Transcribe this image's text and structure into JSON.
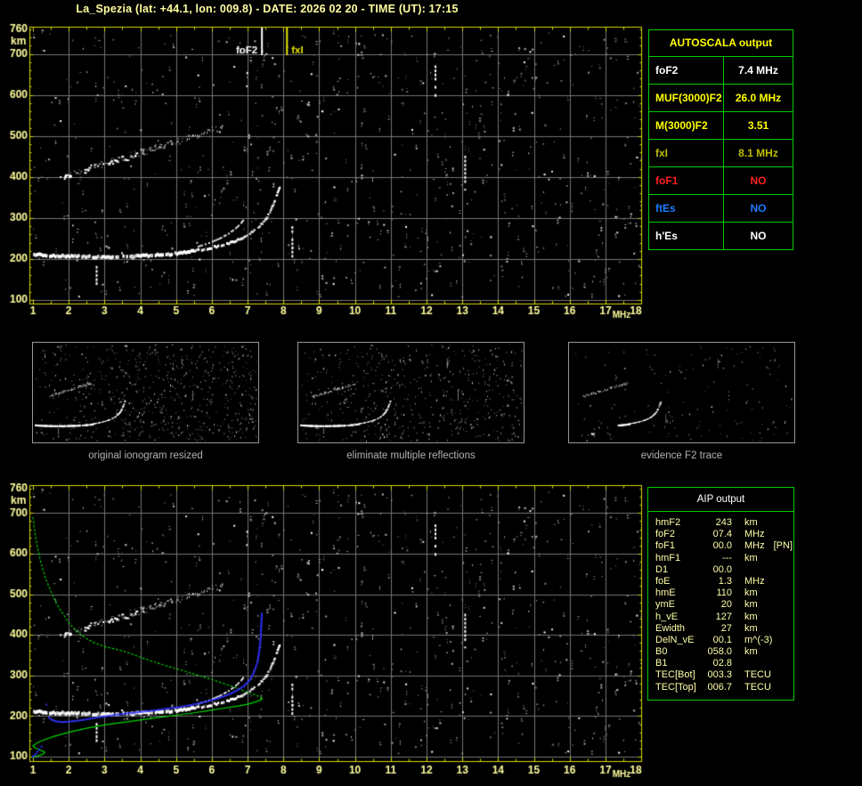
{
  "title": "La_Spezia (lat: +44.1, lon: 009.8) - DATE: 2026 02 20 - TIME (UT): 17:15",
  "autoscala": {
    "header": "AUTOSCALA output",
    "rows": [
      {
        "label": "foF2",
        "value": "7.4 MHz",
        "color": "#ffffff"
      },
      {
        "label": "MUF(3000)F2",
        "value": "26.0 MHz",
        "color": "#ffff00"
      },
      {
        "label": "M(3000)F2",
        "value": "3.51",
        "color": "#ffff00"
      },
      {
        "label": "fxI",
        "value": "8.1 MHz",
        "color": "#bcbc00"
      },
      {
        "label": "foF1",
        "value": "NO",
        "color": "#ff2020"
      },
      {
        "label": "ftEs",
        "value": "NO",
        "color": "#2079ff"
      },
      {
        "label": "h'Es",
        "value": "NO",
        "color": "#ffffff"
      }
    ]
  },
  "aip": {
    "header": "AIP output",
    "rows": [
      {
        "name": "hmF2",
        "value": "243",
        "unit": "km",
        "extra": ""
      },
      {
        "name": "foF2",
        "value": "07.4",
        "unit": "MHz",
        "extra": ""
      },
      {
        "name": "foF1",
        "value": "00.0",
        "unit": "MHz",
        "extra": "[PN]"
      },
      {
        "name": "hmF1",
        "value": "---",
        "unit": "km",
        "extra": ""
      },
      {
        "name": "D1",
        "value": "00.0",
        "unit": "",
        "extra": ""
      },
      {
        "name": "foE",
        "value": "1.3",
        "unit": "MHz",
        "extra": ""
      },
      {
        "name": "hmE",
        "value": "110",
        "unit": "km",
        "extra": ""
      },
      {
        "name": "ymE",
        "value": "20",
        "unit": "km",
        "extra": ""
      },
      {
        "name": "h_vE",
        "value": "127",
        "unit": "km",
        "extra": ""
      },
      {
        "name": "Ewidth",
        "value": "27",
        "unit": "km",
        "extra": ""
      },
      {
        "name": "DelN_vE",
        "value": "00.1",
        "unit": "m^(-3)",
        "extra": ""
      },
      {
        "name": "B0",
        "value": "058.0",
        "unit": "km",
        "extra": ""
      },
      {
        "name": "B1",
        "value": "02.8",
        "unit": "",
        "extra": ""
      },
      {
        "name": "TEC[Bot]",
        "value": "003.3",
        "unit": "TECU",
        "extra": ""
      },
      {
        "name": "TEC[Top]",
        "value": "006.7",
        "unit": "TECU",
        "extra": ""
      }
    ]
  },
  "thumbnails": [
    {
      "caption": "original ionogram resized"
    },
    {
      "caption": "eliminate multiple reflections"
    },
    {
      "caption": "evidence F2 trace"
    }
  ],
  "colors": {
    "background": "#000000",
    "frame": "#d8d800",
    "grid": "#757575",
    "axis_text": "#ffff9e",
    "trace_white": "#ffffff",
    "noise_gray": "#8c8c8c",
    "profile_green": "#00d800",
    "restored_blue": "#3232ff",
    "table_border": "#00cc00",
    "caption_gray": "#b2b2b2"
  },
  "chart_data": {
    "type": "scatter",
    "description": "Two ionograms (virtual height km vs sounding frequency MHz); bottom panel adds AIP electron-density profile (green) and restored trace (blue).",
    "axes": {
      "xlim": [
        1,
        18
      ],
      "ylim": [
        100,
        760
      ],
      "xticks": [
        1,
        2,
        3,
        4,
        5,
        6,
        7,
        8,
        9,
        10,
        11,
        12,
        13,
        14,
        15,
        16,
        17,
        18
      ],
      "yticks": [
        760,
        700,
        600,
        500,
        400,
        300,
        200,
        100
      ],
      "xunit": "MHz",
      "yunit": "km",
      "grid": true
    },
    "markers": [
      {
        "label": "foF2",
        "freq": 7.4,
        "color": "#ffffff"
      },
      {
        "label": "fxI",
        "freq": 8.1,
        "color": "#e8e800"
      }
    ],
    "f_trace": [
      [
        1.0,
        211
      ],
      [
        1.3,
        209
      ],
      [
        1.7,
        207
      ],
      [
        2.1,
        206
      ],
      [
        2.5,
        205
      ],
      [
        3.0,
        205
      ],
      [
        3.4,
        206
      ],
      [
        3.8,
        207
      ],
      [
        4.2,
        208
      ],
      [
        4.6,
        210
      ],
      [
        5.0,
        213
      ],
      [
        5.4,
        218
      ],
      [
        5.8,
        224
      ],
      [
        6.2,
        232
      ],
      [
        6.5,
        240
      ],
      [
        6.8,
        250
      ],
      [
        7.0,
        259
      ],
      [
        7.2,
        271
      ],
      [
        7.35,
        284
      ],
      [
        7.5,
        299
      ],
      [
        7.6,
        316
      ],
      [
        7.7,
        335
      ],
      [
        7.78,
        353
      ],
      [
        7.84,
        368
      ],
      [
        7.88,
        379
      ]
    ],
    "f_trace_secondary": [
      [
        5.55,
        231
      ],
      [
        5.9,
        241
      ],
      [
        6.2,
        252
      ],
      [
        6.45,
        264
      ],
      [
        6.65,
        277
      ],
      [
        6.8,
        290
      ],
      [
        6.9,
        302
      ]
    ],
    "second_hop": {
      "f_min": 1.85,
      "f_max": 5.35,
      "base_h": 402,
      "slope": 27,
      "jitter": 16,
      "count": 120,
      "sparse_count": 26,
      "sparse_f_max": 6.3
    },
    "vertical_bars": [
      [
        2.78,
        126,
        183
      ],
      [
        8.25,
        206,
        280
      ],
      [
        12.25,
        598,
        672
      ],
      [
        13.08,
        383,
        452
      ]
    ],
    "bright_dots": [
      [
        13.08,
        369
      ],
      [
        15.3,
        406
      ],
      [
        16.7,
        402
      ],
      [
        14.9,
        705
      ],
      [
        7.7,
        690
      ],
      [
        11.6,
        515
      ]
    ],
    "profile_upper": [
      [
        1.0,
        690
      ],
      [
        1.05,
        655
      ],
      [
        1.12,
        618
      ],
      [
        1.22,
        578
      ],
      [
        1.35,
        540
      ],
      [
        1.5,
        507
      ],
      [
        1.65,
        478
      ],
      [
        1.8,
        457
      ],
      [
        2.0,
        430
      ],
      [
        2.2,
        410
      ],
      [
        2.45,
        393
      ],
      [
        2.7,
        381
      ],
      [
        3.0,
        371
      ],
      [
        3.3,
        365
      ],
      [
        3.6,
        358
      ],
      [
        4.0,
        345
      ],
      [
        4.4,
        333
      ],
      [
        4.9,
        319
      ],
      [
        5.3,
        309
      ],
      [
        5.7,
        298
      ],
      [
        6.1,
        287
      ],
      [
        6.5,
        275
      ],
      [
        6.9,
        262
      ],
      [
        7.15,
        254
      ],
      [
        7.3,
        249
      ],
      [
        7.38,
        245
      ],
      [
        7.42,
        243
      ]
    ],
    "profile_lower": [
      [
        7.42,
        243
      ],
      [
        7.35,
        239
      ],
      [
        7.2,
        234
      ],
      [
        7.0,
        229
      ],
      [
        6.7,
        224
      ],
      [
        6.3,
        219
      ],
      [
        5.9,
        213
      ],
      [
        5.5,
        208
      ],
      [
        5.0,
        202
      ],
      [
        4.5,
        196
      ],
      [
        4.0,
        190
      ],
      [
        3.5,
        184
      ],
      [
        3.0,
        178
      ],
      [
        2.5,
        170
      ],
      [
        2.0,
        160
      ],
      [
        1.6,
        150
      ],
      [
        1.3,
        141
      ],
      [
        1.12,
        134
      ],
      [
        1.02,
        128
      ],
      [
        1.0,
        127
      ],
      [
        1.05,
        122
      ],
      [
        1.15,
        118
      ],
      [
        1.26,
        114
      ],
      [
        1.33,
        111
      ],
      [
        1.3,
        107
      ],
      [
        1.18,
        103
      ],
      [
        1.05,
        100
      ],
      [
        0.99,
        97
      ]
    ],
    "blue_trace": [
      [
        1.45,
        196
      ],
      [
        1.52,
        191
      ],
      [
        1.6,
        188
      ],
      [
        1.7,
        186
      ],
      [
        1.85,
        185
      ],
      [
        2.0,
        186
      ],
      [
        2.2,
        188
      ],
      [
        2.45,
        191
      ],
      [
        2.7,
        195
      ],
      [
        3.0,
        199
      ],
      [
        3.3,
        203
      ],
      [
        3.6,
        206
      ],
      [
        3.9,
        209
      ],
      [
        4.2,
        212
      ],
      [
        4.5,
        215
      ],
      [
        4.8,
        219
      ],
      [
        5.1,
        222
      ],
      [
        5.4,
        227
      ],
      [
        5.7,
        232
      ],
      [
        6.0,
        239
      ],
      [
        6.25,
        246
      ],
      [
        6.5,
        254
      ],
      [
        6.7,
        263
      ],
      [
        6.9,
        274
      ],
      [
        7.05,
        288
      ],
      [
        7.15,
        302
      ],
      [
        7.22,
        318
      ],
      [
        7.28,
        336
      ],
      [
        7.32,
        356
      ],
      [
        7.35,
        378
      ],
      [
        7.37,
        400
      ],
      [
        7.38,
        420
      ],
      [
        7.39,
        440
      ],
      [
        7.4,
        456
      ]
    ],
    "blue_extra": [
      [
        1.38,
        228
      ],
      [
        1.0,
        100
      ],
      [
        1.04,
        103
      ],
      [
        1.08,
        107
      ],
      [
        1.13,
        112
      ],
      [
        1.18,
        118
      ],
      [
        1.24,
        125
      ]
    ],
    "noise": {
      "seed": 20260220,
      "gray_count": 780,
      "white_count": 55
    },
    "thumbs": {
      "seeds": [
        11,
        12,
        13
      ],
      "noise_counts": [
        680,
        560,
        150
      ]
    }
  }
}
